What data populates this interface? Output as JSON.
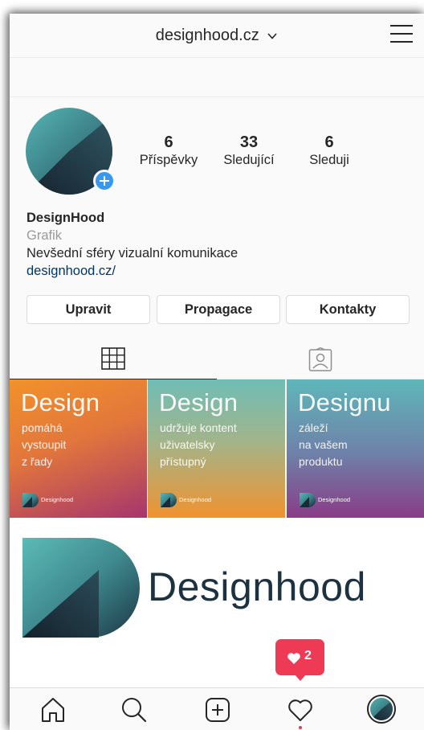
{
  "header": {
    "username": "designhood.cz",
    "menu_icon": "hamburger-menu-icon",
    "dropdown_icon": "chevron-down-icon"
  },
  "profile": {
    "avatar_icon": "designhood-logo-avatar",
    "add_story_icon": "plus-icon",
    "stats": [
      {
        "value": "6",
        "label": "Příspěvky"
      },
      {
        "value": "33",
        "label": "Sledující"
      },
      {
        "value": "6",
        "label": "Sleduji"
      }
    ],
    "name": "DesignHood",
    "category": "Grafik",
    "bio": "Nevšední sféry vizualní komunikace",
    "link": "designhood.cz/"
  },
  "buttons": {
    "edit": "Upravit",
    "promote": "Propagace",
    "contacts": "Kontakty"
  },
  "tabs": [
    {
      "icon": "grid-icon",
      "active": true
    },
    {
      "icon": "tagged-person-icon",
      "active": false
    }
  ],
  "posts": [
    {
      "title": "Design",
      "lines": [
        "pomáhá",
        "vystoupit",
        "z řady"
      ],
      "brand": "Designhood"
    },
    {
      "title": "Design",
      "lines": [
        "udržuje kontent",
        "uživatelsky",
        "přístupný"
      ],
      "brand": "Designhood"
    },
    {
      "title": "Designu",
      "lines": [
        "záleží",
        "na vašem",
        "produktu"
      ],
      "brand": "Designhood"
    }
  ],
  "big_post": {
    "text": "Designhood"
  },
  "notification": {
    "icon": "heart-icon",
    "count": "2"
  },
  "bottom_nav": [
    {
      "icon": "home-icon"
    },
    {
      "icon": "search-icon"
    },
    {
      "icon": "add-post-icon"
    },
    {
      "icon": "heart-icon"
    },
    {
      "icon": "profile-avatar-icon"
    }
  ],
  "colors": {
    "accent_blue": "#3897f0",
    "notification_red": "#ee3a54",
    "link_blue": "#003569",
    "brand_dark": "#1d3241",
    "brand_teal": "#5fb7ba"
  }
}
